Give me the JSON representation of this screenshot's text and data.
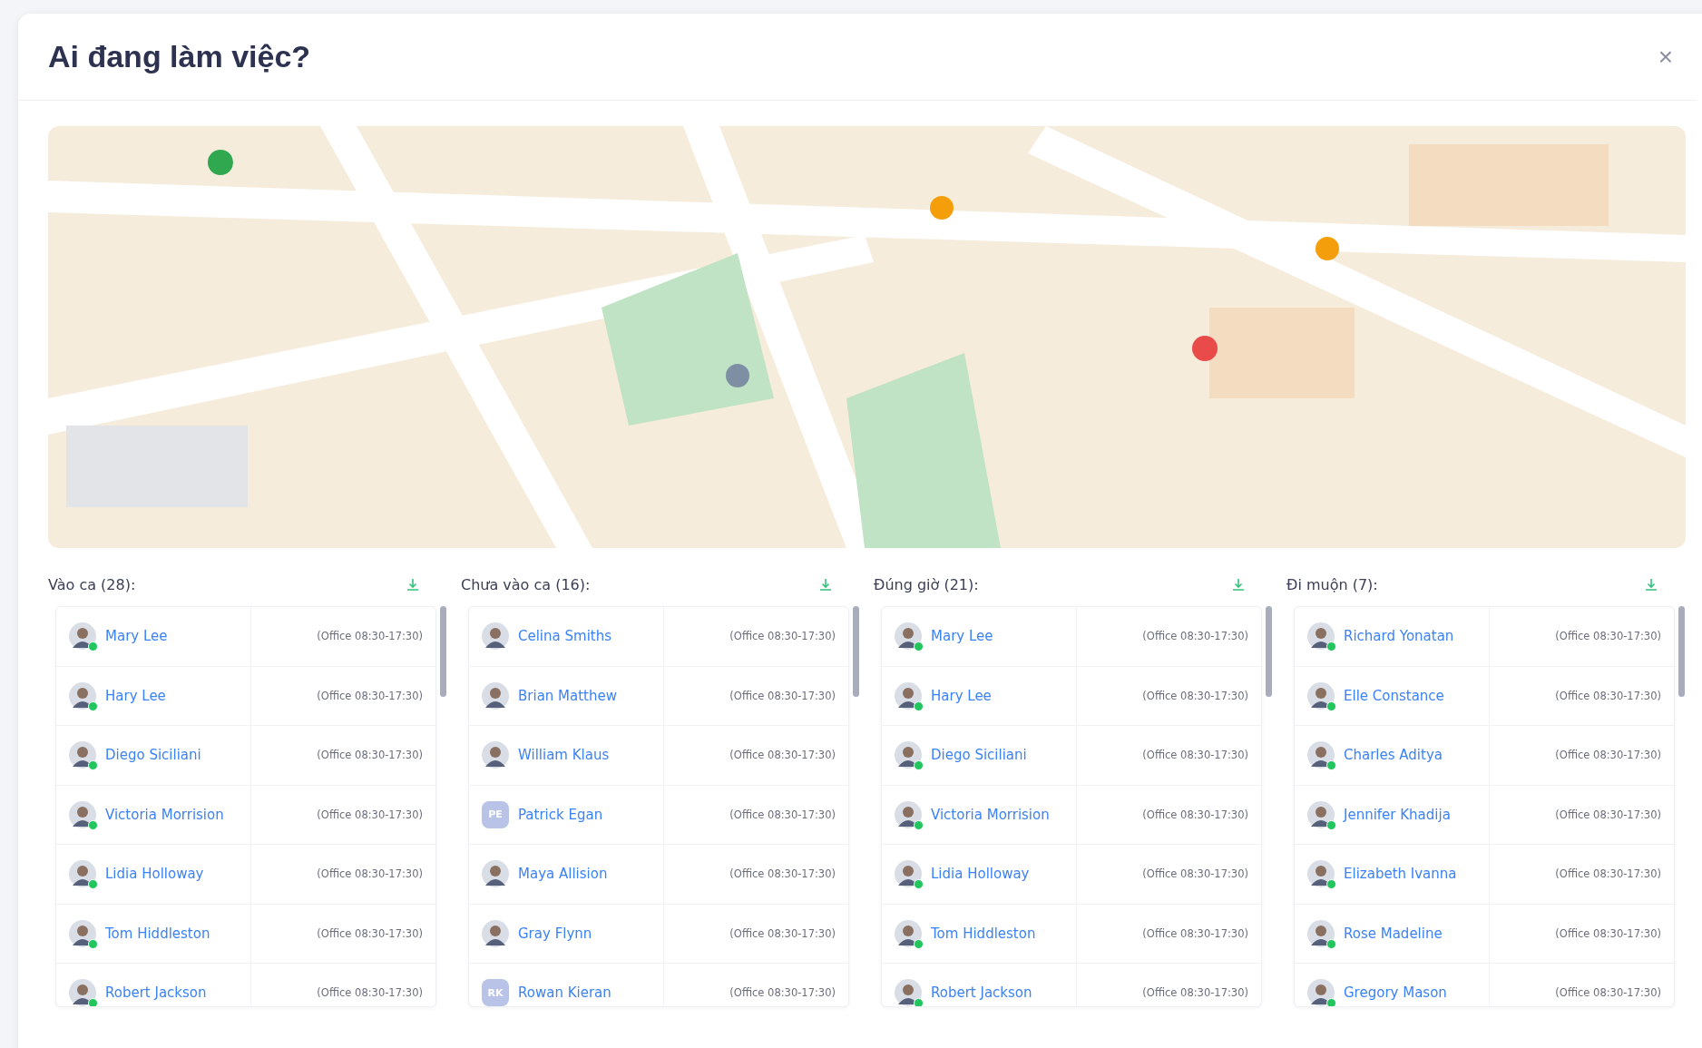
{
  "dialog": {
    "title": "Ai đang làm việc?",
    "close": "×"
  },
  "groups": [
    {
      "title": "Vào ca (28):",
      "people": [
        {
          "name": "Mary Lee",
          "shift": "(Office 08:30-17:30)",
          "online": true
        },
        {
          "name": "Hary Lee",
          "shift": "(Office 08:30-17:30)",
          "online": true
        },
        {
          "name": "Diego Siciliani",
          "shift": "(Office 08:30-17:30)",
          "online": true
        },
        {
          "name": "Victoria Morrision",
          "shift": "(Office 08:30-17:30)",
          "online": true
        },
        {
          "name": "Lidia Holloway",
          "shift": "(Office 08:30-17:30)",
          "online": true
        },
        {
          "name": "Tom Hiddleston",
          "shift": "(Office 08:30-17:30)",
          "online": true
        },
        {
          "name": "Robert Jackson",
          "shift": "(Office 08:30-17:30)",
          "online": true
        }
      ]
    },
    {
      "title": "Chưa vào ca (16):",
      "people": [
        {
          "name": "Celina Smiths",
          "shift": "(Office 08:30-17:30)",
          "online": false
        },
        {
          "name": "Brian Matthew",
          "shift": "(Office 08:30-17:30)",
          "online": false
        },
        {
          "name": "William Klaus",
          "shift": "(Office 08:30-17:30)",
          "online": false
        },
        {
          "name": "Patrick Egan",
          "shift": "(Office 08:30-17:30)",
          "kind": "initials",
          "initials": "PE",
          "online": false
        },
        {
          "name": "Maya Allision",
          "shift": "(Office 08:30-17:30)",
          "online": false
        },
        {
          "name": "Gray Flynn",
          "shift": "(Office 08:30-17:30)",
          "online": false
        },
        {
          "name": "Rowan Kieran",
          "shift": "(Office 08:30-17:30)",
          "kind": "initials",
          "initials": "RK",
          "online": false
        }
      ]
    },
    {
      "title": "Đúng giờ (21):",
      "people": [
        {
          "name": "Mary Lee",
          "shift": "(Office 08:30-17:30)",
          "online": true
        },
        {
          "name": "Hary Lee",
          "shift": "(Office 08:30-17:30)",
          "online": true
        },
        {
          "name": "Diego Siciliani",
          "shift": "(Office 08:30-17:30)",
          "online": true
        },
        {
          "name": "Victoria Morrision",
          "shift": "(Office 08:30-17:30)",
          "online": true
        },
        {
          "name": "Lidia Holloway",
          "shift": "(Office 08:30-17:30)",
          "online": true
        },
        {
          "name": "Tom Hiddleston",
          "shift": "(Office 08:30-17:30)",
          "online": true
        },
        {
          "name": "Robert Jackson",
          "shift": "(Office 08:30-17:30)",
          "online": true
        }
      ]
    },
    {
      "title": "Đi muộn (7):",
      "people": [
        {
          "name": "Richard Yonatan",
          "shift": "(Office 08:30-17:30)",
          "online": true
        },
        {
          "name": "Elle Constance",
          "shift": "(Office 08:30-17:30)",
          "online": true
        },
        {
          "name": "Charles Aditya",
          "shift": "(Office 08:30-17:30)",
          "online": true
        },
        {
          "name": "Jennifer Khadija",
          "shift": "(Office 08:30-17:30)",
          "online": true
        },
        {
          "name": "Elizabeth Ivanna",
          "shift": "(Office 08:30-17:30)",
          "online": true
        },
        {
          "name": "Rose Madeline",
          "shift": "(Office 08:30-17:30)",
          "online": true
        },
        {
          "name": "Gregory Mason",
          "shift": "(Office 08:30-17:30)",
          "online": true
        }
      ]
    }
  ]
}
